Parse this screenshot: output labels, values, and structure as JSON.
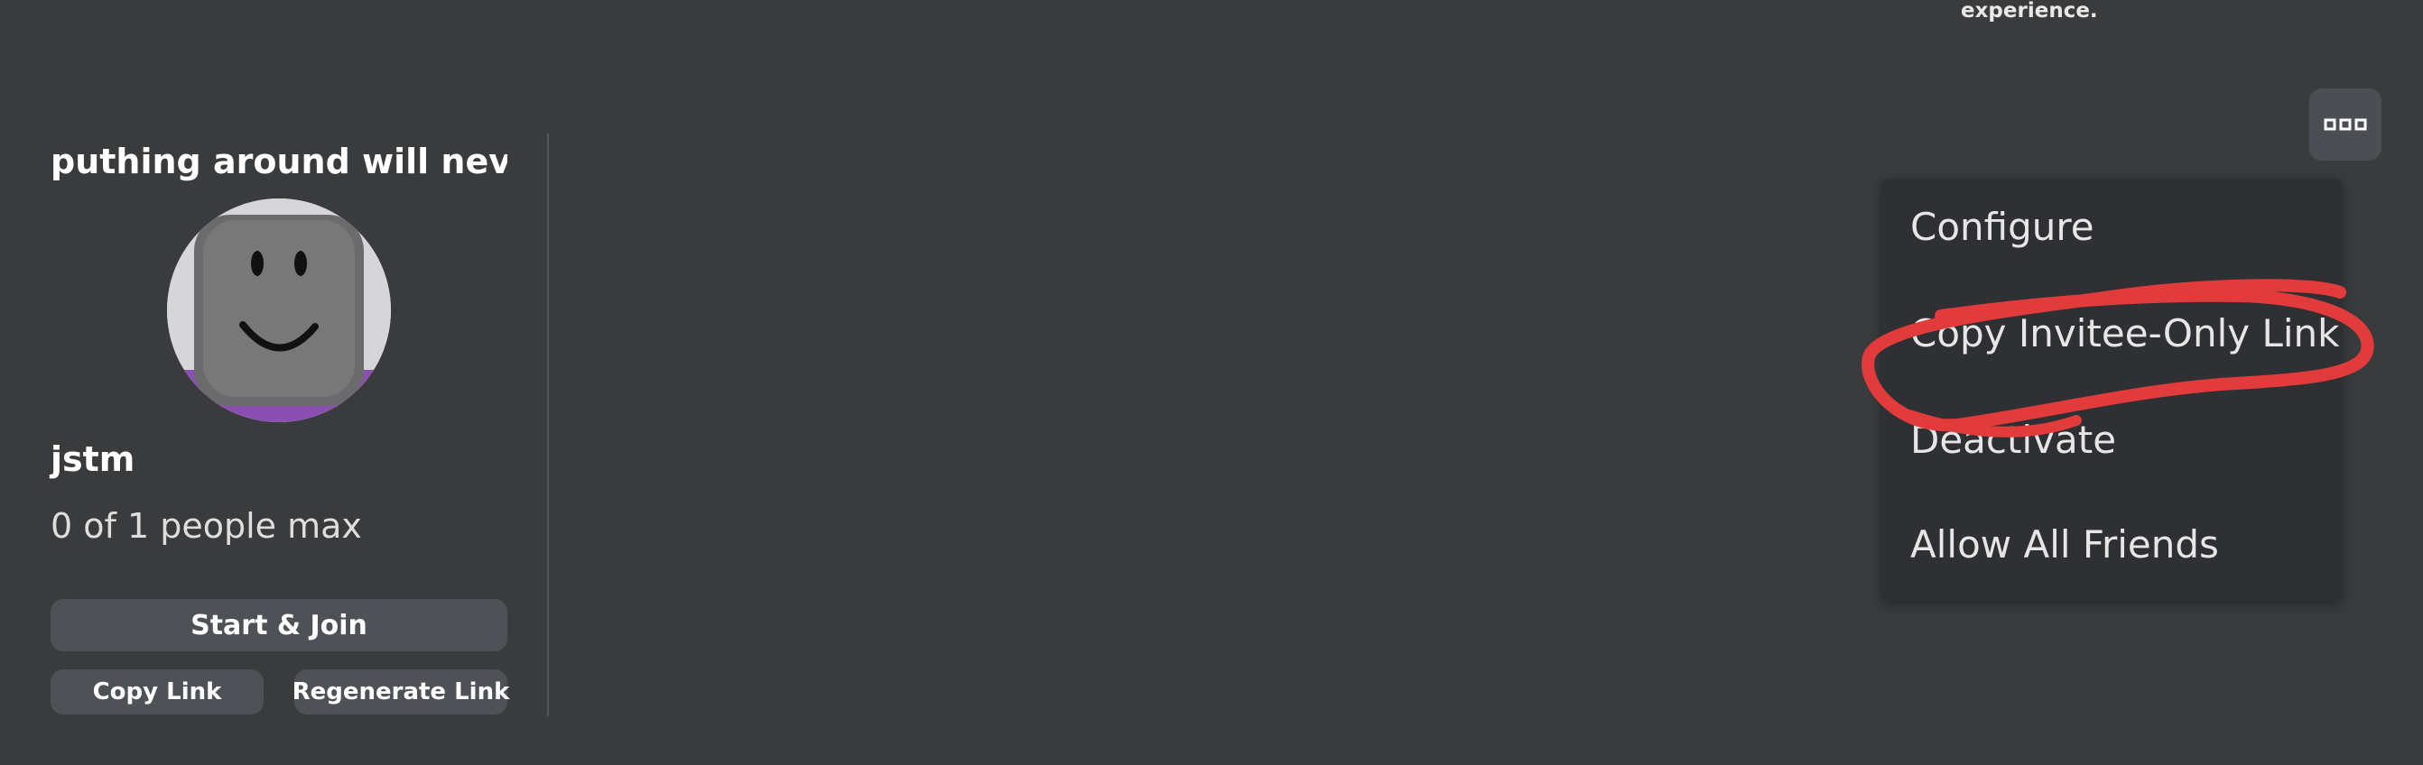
{
  "top_note": "experience.",
  "server": {
    "name": "puthing around will never",
    "owner": "jstm",
    "capacity": "0 of 1 people max",
    "start_join_label": "Start & Join",
    "copy_link_label": "Copy Link",
    "regenerate_link_label": "Regenerate Link"
  },
  "more_button": {
    "icon": "ellipsis-icon"
  },
  "menu": {
    "items": [
      {
        "label": "Configure"
      },
      {
        "label": "Copy Invitee-Only Link"
      },
      {
        "label": "Deactivate"
      },
      {
        "label": "Allow All Friends"
      }
    ]
  },
  "colors": {
    "background": "#393b3d",
    "menu_background": "#2e3033",
    "button_background": "#4e5156",
    "annotation_red": "#e23b3b",
    "avatar_accent": "#8a4fb0"
  }
}
